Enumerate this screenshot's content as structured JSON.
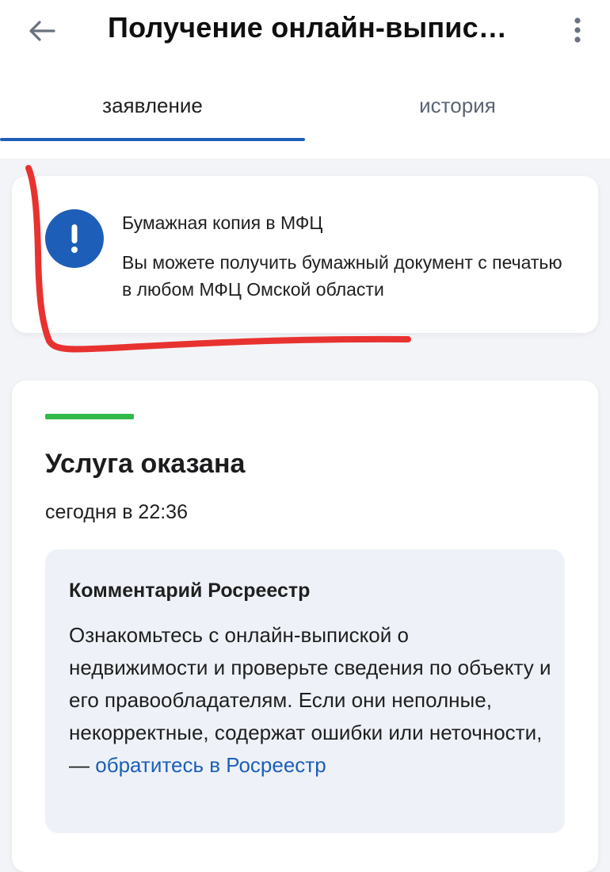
{
  "header": {
    "title": "Получение онлайн-выпис…",
    "back_icon": "arrow-left-icon",
    "menu_icon": "more-vertical-icon"
  },
  "tabs": [
    {
      "label": "заявление",
      "active": true
    },
    {
      "label": "история",
      "active": false
    }
  ],
  "notice": {
    "icon": "exclamation-icon",
    "title": "Бумажная копия в МФЦ",
    "text": "Вы можете получить бумажный документ с печатью в любом МФЦ Омской области"
  },
  "status": {
    "title": "Услуга оказана",
    "date": "сегодня в 22:36",
    "indicator_color": "#33b84a"
  },
  "comment": {
    "title": "Комментарий Росреестр",
    "text": "Ознакомьтесь с онлайн-выпиской о недвижимости и проверьте сведения по объекту и его правообладателям. Если они неполные, некорректные, содержат ошибки или неточности, — ",
    "link": "обратитесь в Росреестр"
  },
  "colors": {
    "accent": "#1d5fb8",
    "success": "#33b84a",
    "annotation": "#e8322f"
  }
}
